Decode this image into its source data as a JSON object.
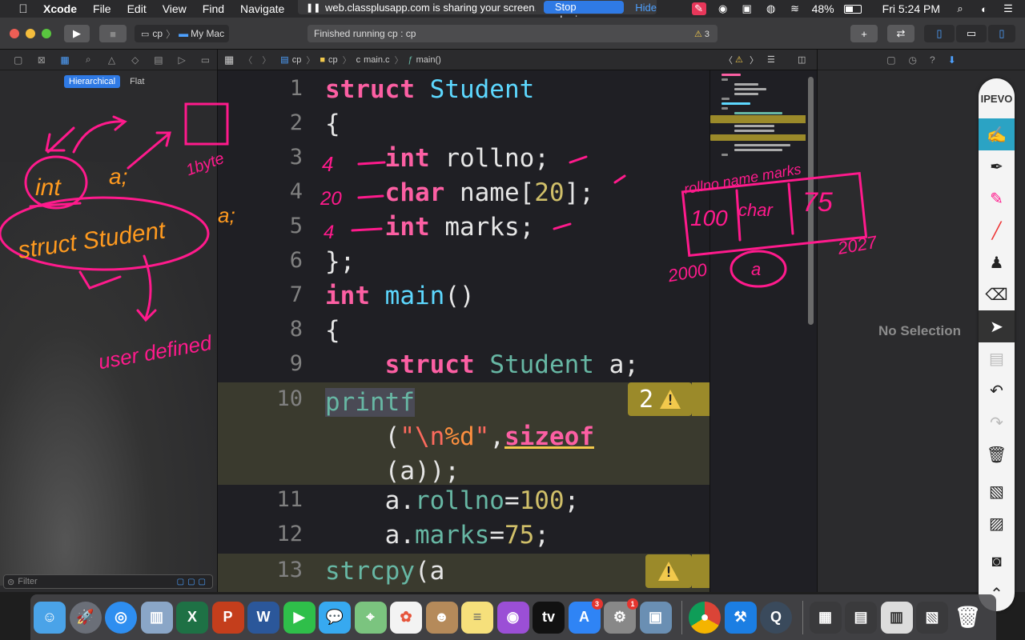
{
  "menubar": {
    "app": "Xcode",
    "items": [
      "File",
      "Edit",
      "View",
      "Find",
      "Navigate"
    ],
    "share_text": "web.classplusapp.com is sharing your screen.",
    "stop_sharing": "Stop sharing",
    "hide": "Hide",
    "battery": "48%",
    "clock": "Fri 5:24 PM"
  },
  "toolbar": {
    "scheme": "cp",
    "destination": "My Mac",
    "activity": "Finished running cp : cp",
    "warning_count": "3"
  },
  "navigator": {
    "mode_hierarchical": "Hierarchical",
    "mode_flat": "Flat",
    "filter_placeholder": "Filter"
  },
  "jumpbar": {
    "project": "cp",
    "folder": "cp",
    "file": "main.c",
    "symbol": "main()"
  },
  "editor": {
    "line_numbers": [
      "1",
      "2",
      "3",
      "4",
      "5",
      "6",
      "7",
      "8",
      "9",
      "10",
      "11",
      "12",
      "13"
    ],
    "warning_badge_count": "2"
  },
  "inspector": {
    "no_selection": "No Selection"
  },
  "ipevo": {
    "logo": "IPEVO"
  },
  "annotations": {
    "a1": "int",
    "a2": "a;",
    "a3": "struct Student",
    "a4": "a;",
    "a5": "user defined",
    "a6": "1byte",
    "a7": "4",
    "a8": "20",
    "a9": "4",
    "a10": "rollno  name  marks",
    "a11": "100",
    "a12": "char",
    "a13": "75",
    "a14": "2000",
    "a15": "2027",
    "a16": "a"
  },
  "colors": {
    "keyword": "#fc5fa3",
    "type": "#5dd8ff",
    "number": "#d0bf69",
    "annotation_pink": "#ff1a8c",
    "annotation_orange": "#ff9a1f"
  }
}
